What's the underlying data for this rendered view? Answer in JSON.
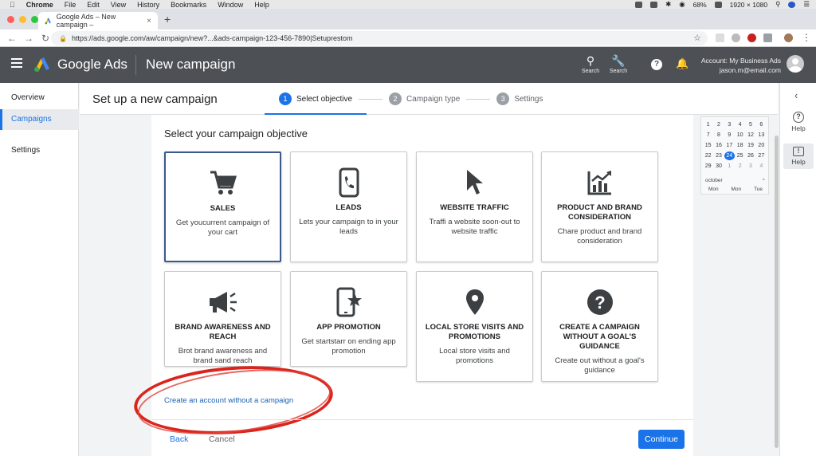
{
  "mac_menubar": {
    "menus": [
      "Chrome",
      "File",
      "Edit",
      "View",
      "History",
      "Bookmarks",
      "Window",
      "Help"
    ],
    "battery": "68%",
    "resolution": "1920 × 1080"
  },
  "browser": {
    "tab_title": "Google Ads – New campaign –",
    "url": "https://ads.google.com/aw/campaign/new?...&ads-campaign-123-456-7890|Setuprestom"
  },
  "header": {
    "product": "Google Ads",
    "page": "New campaign",
    "search_label": "Search",
    "tools_label": "Search",
    "account_label": "Account: My Business Ads",
    "account_email": "jason.m@email.com"
  },
  "leftnav": {
    "items": [
      {
        "label": "Overview"
      },
      {
        "label": "Campaigns"
      },
      {
        "label": "Settings"
      }
    ]
  },
  "main": {
    "title": "Set up a new campaign",
    "steps": [
      {
        "num": "1",
        "label": "Select objective"
      },
      {
        "num": "2",
        "label": "Campaign type"
      },
      {
        "num": "3",
        "label": "Settings"
      }
    ],
    "objective_title": "Select your campaign objective",
    "cards": [
      {
        "icon": "cart-icon",
        "title": "SALES",
        "desc": "Get youcurrent campaign of your cart"
      },
      {
        "icon": "phone-icon",
        "title": "LEADS",
        "desc": "Lets your campaign to in your leads"
      },
      {
        "icon": "cursor-icon",
        "title": "WEBSITE TRAFFIC",
        "desc": "Traffi a website soon-out to website traffic"
      },
      {
        "icon": "chart-icon",
        "title": "PRODUCT AND BRAND CONSIDERATION",
        "desc": "Chare product and brand consideration"
      },
      {
        "icon": "megaphone-icon",
        "title": "BRAND AWARENESS AND REACH",
        "desc": "Brot brand awareness and brand sand reach"
      },
      {
        "icon": "app-star-icon",
        "title": "APP PROMOTION",
        "desc": "Get startstarr on ending app promotion"
      },
      {
        "icon": "location-pin-icon",
        "title": "LOCAL STORE VISITS AND PROMOTIONS",
        "desc": "Local store visits and promotions"
      },
      {
        "icon": "question-icon",
        "title": "CREATE A CAMPAIGN WITHOUT A GOAL'S GUIDANCE",
        "desc": "Create out without a goal's guidance"
      }
    ],
    "no_campaign_link": "Create an account without a campaign",
    "back": "Back",
    "cancel": "Cancel",
    "continue": "Continue"
  },
  "calendar": {
    "days": [
      "1",
      "2",
      "3",
      "4",
      "5",
      "6",
      "7",
      "8",
      "9",
      "10",
      "12",
      "13",
      "15",
      "16",
      "17",
      "18",
      "19",
      "20",
      "22",
      "23",
      "24",
      "25",
      "26",
      "27",
      "29",
      "30",
      "1",
      "2",
      "3",
      "4"
    ],
    "today": "24",
    "month2": "october",
    "weekdays": [
      "Mon",
      "Mon",
      "Tue"
    ]
  },
  "rightpanel": {
    "help1": "Help",
    "help2": "Help"
  },
  "colors": {
    "accent": "#1a73e8",
    "header_bg": "#4d5156",
    "annotation_red": "#d9251c"
  }
}
